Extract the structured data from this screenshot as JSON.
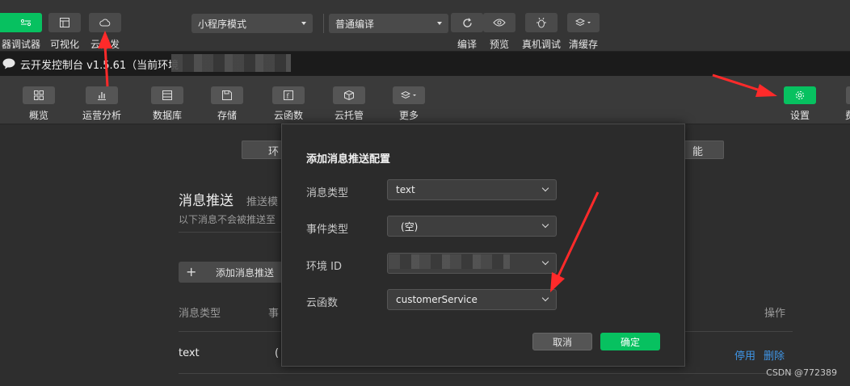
{
  "toolbar": {
    "left_items": [
      {
        "label": "器",
        "icon": "editor-icon",
        "green": true
      },
      {
        "label": "调试器",
        "icon": "debugger-icon",
        "green": true
      },
      {
        "label": "可视化",
        "icon": "visual-icon",
        "green": false
      },
      {
        "label": "云开发",
        "icon": "cloud-icon",
        "green": false
      }
    ],
    "mode_select": "小程序模式",
    "compile_select": "普通编译",
    "right_items": [
      {
        "label": "编译",
        "icon": "refresh-icon"
      },
      {
        "label": "预览",
        "icon": "eye-icon"
      },
      {
        "label": "真机调试",
        "icon": "bug-icon"
      },
      {
        "label": "清缓存",
        "icon": "layers-icon"
      }
    ]
  },
  "titlebar": {
    "title": "云开发控制台 v1.5.61（当前环境"
  },
  "console_nav": {
    "items": [
      {
        "label": "概览",
        "icon": "grid-icon"
      },
      {
        "label": "运营分析",
        "icon": "bar-chart-icon"
      },
      {
        "label": "数据库",
        "icon": "database-icon"
      },
      {
        "label": "存储",
        "icon": "save-icon"
      },
      {
        "label": "云函数",
        "icon": "function-icon"
      },
      {
        "label": "云托管",
        "icon": "box-icon"
      },
      {
        "label": "更多",
        "icon": "layers-icon"
      }
    ],
    "settings_label": "设置",
    "cut_label": "费"
  },
  "page": {
    "tab_left": "环",
    "tab_right": "能",
    "section_title": "消息推送",
    "section_sub": "推送模",
    "hint": "以下消息不会被推送至",
    "add_button": "添加消息推送",
    "col_type": "消息类型",
    "col_event": "事",
    "col_ops": "操作",
    "row_type": "text",
    "row_event": "(",
    "row_disable": "停用",
    "row_delete": "删除"
  },
  "modal": {
    "title": "添加消息推送配置",
    "fields": {
      "msg_type_label": "消息类型",
      "msg_type_value": "text",
      "event_type_label": "事件类型",
      "event_type_value": "(空)",
      "env_id_label": "环境 ID",
      "env_id_value": "",
      "function_label": "云函数",
      "function_value": "customerService"
    },
    "cancel": "取消",
    "confirm": "确定"
  },
  "watermark": "CSDN @772389",
  "colors": {
    "accent_green": "#07c160",
    "link_blue": "#3f95e6",
    "annotation_red": "#ff2a2a"
  }
}
